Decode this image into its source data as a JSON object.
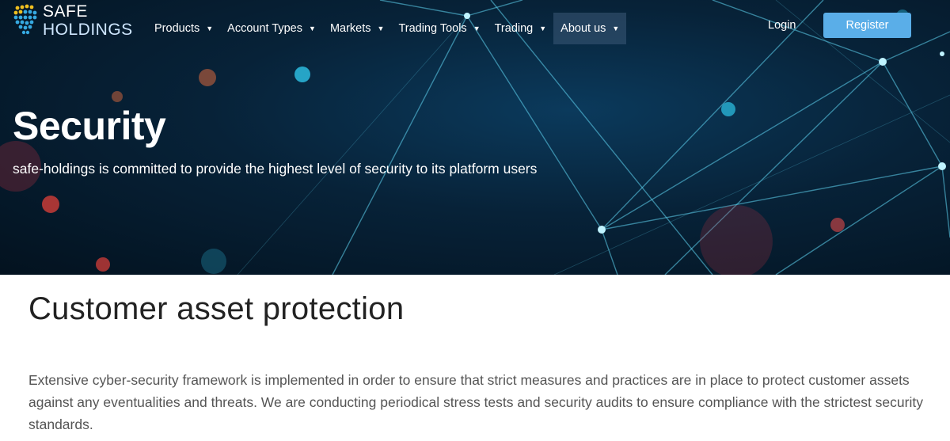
{
  "brand": {
    "line1": "SAFE",
    "line2": "HOLDINGS"
  },
  "nav": {
    "items": [
      {
        "label": "Products",
        "caret": "▼"
      },
      {
        "label": "Account Types",
        "caret": "▼"
      },
      {
        "label": "Markets",
        "caret": "▼"
      },
      {
        "label": "Trading Tools",
        "caret": "▼"
      },
      {
        "label": "Trading",
        "caret": "▼"
      },
      {
        "label": "About us",
        "caret": "▼"
      }
    ],
    "login": "Login",
    "register": "Register"
  },
  "hero": {
    "title": "Security",
    "subtitle": "safe-holdings is committed to provide the highest level of security to its platform users"
  },
  "section": {
    "title": "Customer asset protection",
    "body": "Extensive cyber-security framework is implemented in order to ensure that strict measures and practices are in place to protect customer assets against any eventualities and threats. We are conducting periodical stress tests and security audits to ensure compliance with the strictest security standards."
  },
  "colors": {
    "accent": "#5aaee8",
    "hero_bg": "#072238",
    "active_nav": "#3c5a78",
    "heading": "#222222",
    "body_text": "#555555"
  }
}
